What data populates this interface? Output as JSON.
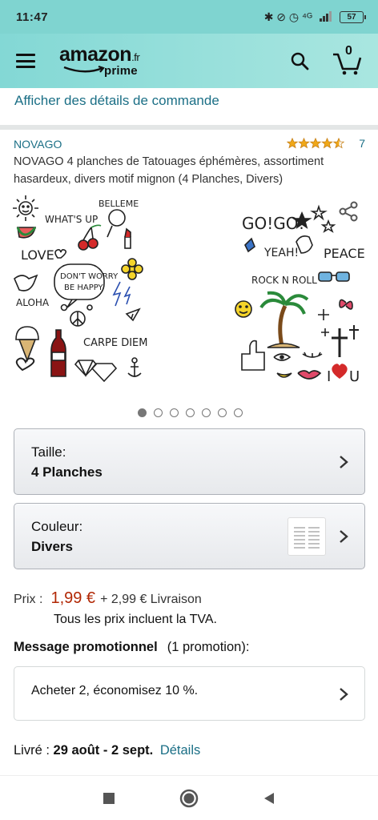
{
  "status_bar": {
    "time": "11:47",
    "icons_text": "✱ ⊘ ◷ ⁴ᴳ",
    "battery": "57"
  },
  "header": {
    "logo_text": "amazon",
    "logo_tld": ".fr",
    "logo_sub": "prime",
    "cart_count": "0"
  },
  "order_details_link": "Afficher des détails de commande",
  "product": {
    "brand": "NOVAGO",
    "rating_count": "7",
    "title": "NOVAGO 4 planches de Tatouages éphémères, assortiment hasardeux, divers motif mignon (4 Planches, Divers)",
    "image_left": {
      "texts": [
        "BELLEME",
        "WHAT'S UP",
        "LOVE",
        "DON'T WORRY",
        "BE HAPPY",
        "ALOHA",
        "CARPE DIEM"
      ]
    },
    "image_right": {
      "texts": [
        "GO!GO!",
        "YEAH!",
        "PEACE",
        "ROCK N ROLL",
        "I",
        "U"
      ]
    },
    "dots_total": 7,
    "dots_active": 0
  },
  "options": {
    "size": {
      "label": "Taille:",
      "value": "4 Planches"
    },
    "color": {
      "label": "Couleur:",
      "value": "Divers"
    }
  },
  "price": {
    "label": "Prix :",
    "amount": "1,99 €",
    "shipping": "+ 2,99 € Livraison",
    "tva_note": "Tous les prix incluent la TVA."
  },
  "promo": {
    "title": "Message promotionnel",
    "count": "(1 promotion):",
    "text": "Acheter 2, économisez 10 %."
  },
  "delivery": {
    "label": "Livré :",
    "dates": "29 août - 2 sept.",
    "link": "Détails"
  },
  "colors": {
    "accent_link": "#1b6f86",
    "price": "#b12704",
    "header": "#83d8d5",
    "stars": "#f0a818"
  }
}
